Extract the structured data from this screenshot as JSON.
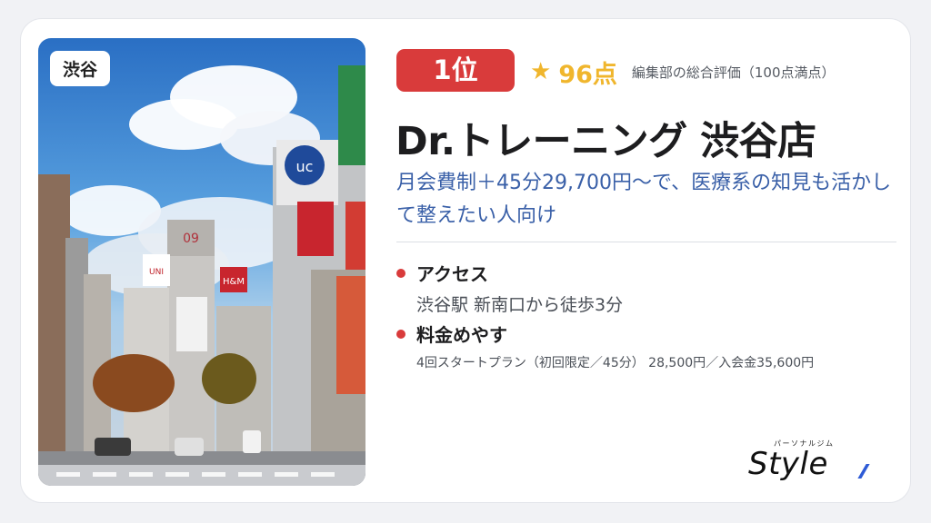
{
  "photo": {
    "area_badge": "渋谷"
  },
  "ranking": {
    "rank": "1位",
    "star": "★",
    "score": "96点",
    "score_caption": "編集部の総合評価（100点満点）"
  },
  "shop": {
    "name": "Dr.トレーニング 渋谷店",
    "catch_copy": "月会費制＋45分29,700円〜で、医療系の知見も活かして整えたい人向け"
  },
  "access": {
    "heading": "アクセス",
    "text": "渋谷駅 新南口から徒歩3分"
  },
  "price": {
    "heading": "料金めやす",
    "text": "4回スタートプラン（初回限定／45分） 28,500円／入会金35,600円"
  },
  "logo": {
    "ruby": "パーソナルジム",
    "word": "Style"
  },
  "colors": {
    "accent_red": "#d93b3b",
    "score_gold": "#f0b62d",
    "catch_blue": "#3a60a8"
  }
}
